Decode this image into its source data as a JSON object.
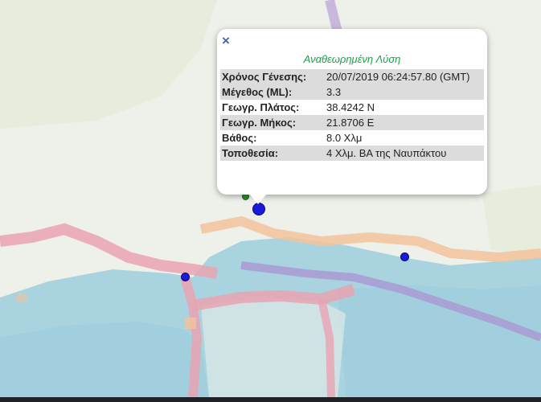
{
  "popup": {
    "close_symbol": "×",
    "title": "Αναθεωρημένη Λύση",
    "rows": [
      {
        "label": "Χρόνος Γένεσης:",
        "value": "20/07/2019 06:24:57.80 (GMT)"
      },
      {
        "label": "Μέγεθος (ML):",
        "value": "3.3"
      },
      {
        "label": "Γεωγρ. Πλάτος:",
        "value": "38.4242 N"
      },
      {
        "label": "Γεωγρ. Μήκος:",
        "value": "21.8706 E"
      },
      {
        "label": "Βάθος:",
        "value": "8.0 Χλμ"
      },
      {
        "label": "Τοποθεσία:",
        "value": "4 Χλμ. ΒΑ της Ναυπάκτου"
      }
    ]
  },
  "colors": {
    "popup_title": "#13a64a",
    "marker_blue": "#1a1ad9",
    "marker_green": "#2e8b2e",
    "water": "#a9d3df",
    "road_pink": "#e9a3b3",
    "road_orange": "#f2c39b",
    "purple_line": "#a99ad3"
  }
}
